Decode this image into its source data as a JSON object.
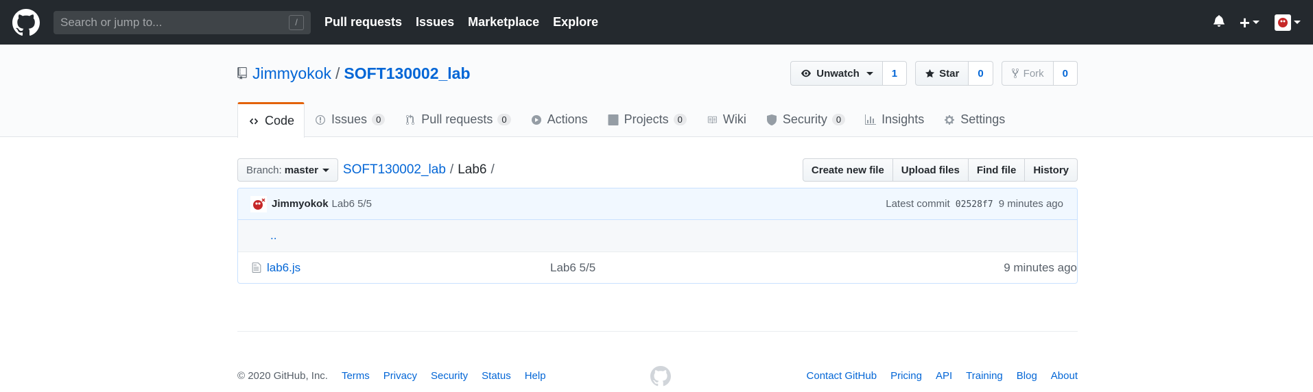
{
  "header": {
    "search_placeholder": "Search or jump to...",
    "search_shortcut": "/",
    "nav": [
      "Pull requests",
      "Issues",
      "Marketplace",
      "Explore"
    ]
  },
  "repo": {
    "owner": "Jimmyokok",
    "separator": "/",
    "name": "SOFT130002_lab",
    "watch_label": "Unwatch",
    "watch_count": "1",
    "star_label": "Star",
    "star_count": "0",
    "fork_label": "Fork",
    "fork_count": "0"
  },
  "tabs": [
    {
      "label": "Code",
      "icon": "code-icon",
      "count": null
    },
    {
      "label": "Issues",
      "icon": "issue-icon",
      "count": "0"
    },
    {
      "label": "Pull requests",
      "icon": "pull-request-icon",
      "count": "0"
    },
    {
      "label": "Actions",
      "icon": "play-icon",
      "count": null
    },
    {
      "label": "Projects",
      "icon": "project-icon",
      "count": "0"
    },
    {
      "label": "Wiki",
      "icon": "book-icon",
      "count": null
    },
    {
      "label": "Security",
      "icon": "shield-icon",
      "count": "0"
    },
    {
      "label": "Insights",
      "icon": "graph-icon",
      "count": null
    },
    {
      "label": "Settings",
      "icon": "gear-icon",
      "count": null
    }
  ],
  "filenav": {
    "branch_prefix": "Branch:",
    "branch": "master",
    "crumb_root": "SOFT130002_lab",
    "crumb_sep": "/",
    "crumb_dir": "Lab6",
    "crumb_end": "/",
    "buttons": [
      "Create new file",
      "Upload files",
      "Find file",
      "History"
    ]
  },
  "commit": {
    "author": "Jimmyokok",
    "message": "Lab6 5/5",
    "latest_label": "Latest commit",
    "sha": "02528f7",
    "age": "9 minutes ago"
  },
  "files": {
    "up": "..",
    "items": [
      {
        "name": "lab6.js",
        "message": "Lab6 5/5",
        "age": "9 minutes ago"
      }
    ]
  },
  "footer": {
    "copyright": "© 2020 GitHub, Inc.",
    "left_links": [
      "Terms",
      "Privacy",
      "Security",
      "Status",
      "Help"
    ],
    "right_links": [
      "Contact GitHub",
      "Pricing",
      "API",
      "Training",
      "Blog",
      "About"
    ]
  },
  "colors": {
    "header_bg": "#24292e",
    "link": "#0366d6",
    "active_tab_accent": "#e36209",
    "commit_bar_bg": "#f1f8ff"
  }
}
